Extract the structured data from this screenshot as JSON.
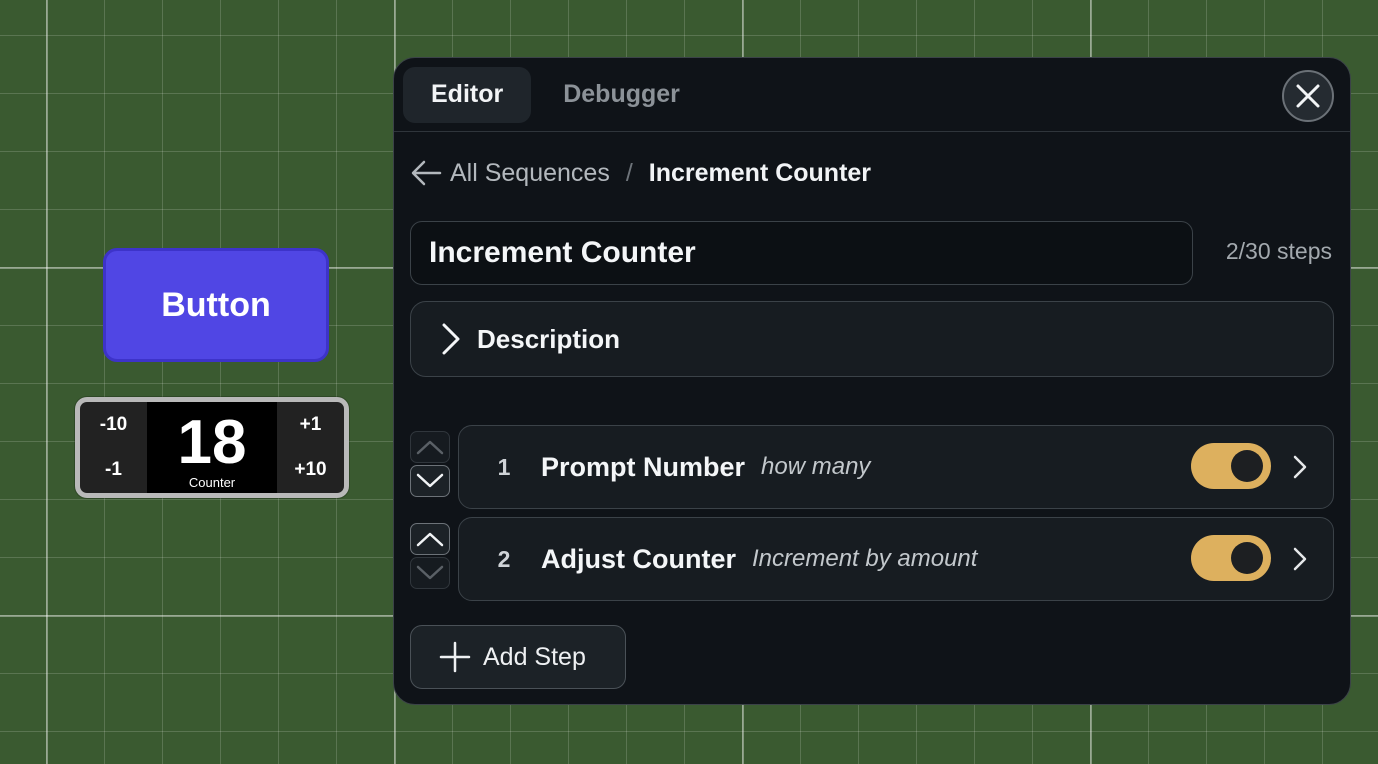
{
  "canvas": {
    "button_label": "Button",
    "counter": {
      "value": "18",
      "label": "Counter",
      "minus_ten": "-10",
      "minus_one": "-1",
      "plus_one": "+1",
      "plus_ten": "+10"
    }
  },
  "panel": {
    "tabs": [
      {
        "label": "Editor",
        "active": true
      },
      {
        "label": "Debugger",
        "active": false
      }
    ],
    "close_icon": "close-icon",
    "breadcrumb": {
      "back_label": "All Sequences",
      "separator": "/",
      "current": "Increment Counter"
    },
    "sequence_name": "Increment Counter",
    "step_count": "2/30 steps",
    "description_label": "Description",
    "steps": [
      {
        "number": "1",
        "name": "Prompt Number",
        "description": "how many",
        "enabled": true
      },
      {
        "number": "2",
        "name": "Adjust Counter",
        "description": "Increment by amount",
        "enabled": true
      }
    ],
    "add_step_label": "Add Step"
  },
  "colors": {
    "canvas_bg": "#3a5a30",
    "button_purple": "#5046e4",
    "panel_bg": "#0f1318",
    "toggle_on": "#ddb05e"
  }
}
